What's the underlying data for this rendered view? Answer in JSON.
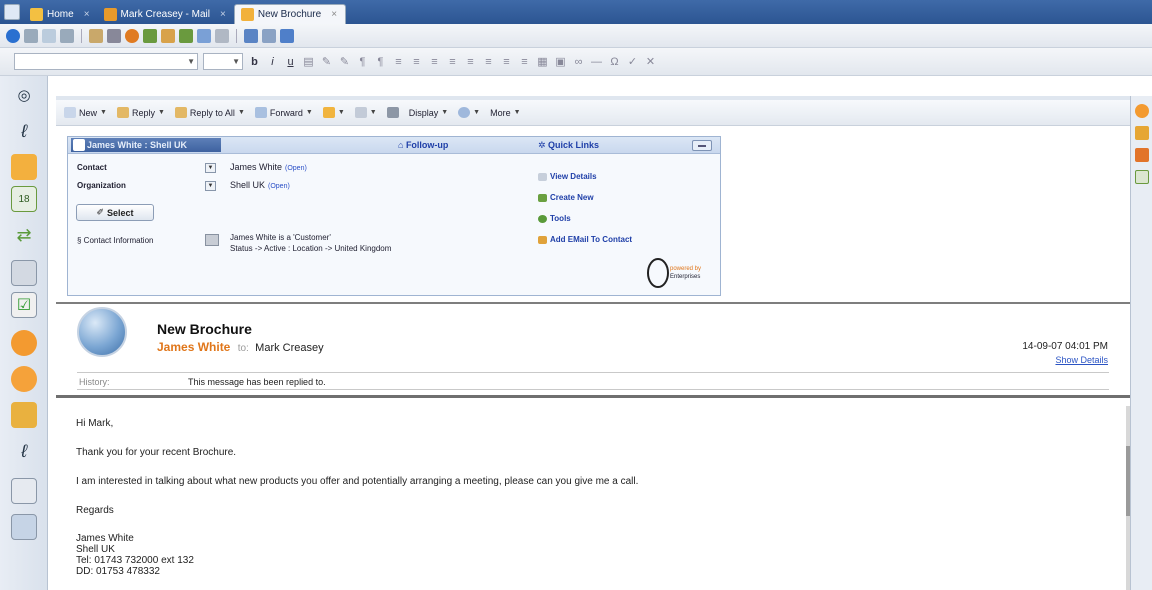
{
  "tabs": [
    {
      "label": "Home",
      "active": false
    },
    {
      "label": "Mark Creasey - Mail",
      "active": false
    },
    {
      "label": "New Brochure",
      "active": true
    }
  ],
  "tab_close_glyph": "×",
  "actions": [
    {
      "label": "New",
      "icon": "new-icon"
    },
    {
      "label": "Reply",
      "icon": "reply-icon"
    },
    {
      "label": "Reply to All",
      "icon": "reply-all-icon"
    },
    {
      "label": "Forward",
      "icon": "forward-icon"
    },
    {
      "label": "",
      "icon": "folder-icon"
    },
    {
      "label": "",
      "icon": "flag-icon"
    },
    {
      "label": "",
      "icon": "delete-icon"
    },
    {
      "label": "Display",
      "icon": "display-icon"
    },
    {
      "label": "",
      "icon": "search-icon"
    },
    {
      "label": "More",
      "icon": "more-icon"
    }
  ],
  "crm": {
    "title": "James White : Shell UK",
    "follow_up": "Follow-up",
    "quick_links": "Quick Links",
    "contact_label": "Contact",
    "contact_value": "James White",
    "organization_label": "Organization",
    "organization_value": "Shell UK",
    "open_label": "(Open)",
    "select_label": "Select",
    "contact_info_label": "Contact Information",
    "contact_info_line1": "James White is a 'Customer'",
    "contact_info_line2": "Status -> Active : Location -> United Kingdom",
    "links": [
      "View Details",
      "Create New",
      "Tools",
      "Add EMail To Contact"
    ],
    "powered_line1": "powered by",
    "powered_line2": "Enterprises"
  },
  "message": {
    "subject": "New Brochure",
    "from": "James White",
    "to_label": "to:",
    "to": "Mark Creasey",
    "date": "14-09-07 04:01 PM",
    "show_details": "Show Details",
    "history_label": "History:",
    "history_value": "This message has been replied to."
  },
  "body": {
    "greeting": "Hi Mark,",
    "line1": "Thank you for your recent Brochure.",
    "line2": "I am interested in talking about what new products you offer and potentially arranging a meeting, please can you give me a call.",
    "regards": "Regards",
    "sig_name": "James White",
    "sig_company": "Shell UK",
    "sig_tel": "Tel: 01743 732000 ext 132",
    "sig_dd": "DD: 01753 478332"
  },
  "colors": {
    "tabbar": "#2c5592",
    "link_blue": "#1f3fa8",
    "sender_orange": "#e0761a"
  },
  "format_bar": {
    "glyphs": [
      "b",
      "i",
      "u"
    ]
  }
}
